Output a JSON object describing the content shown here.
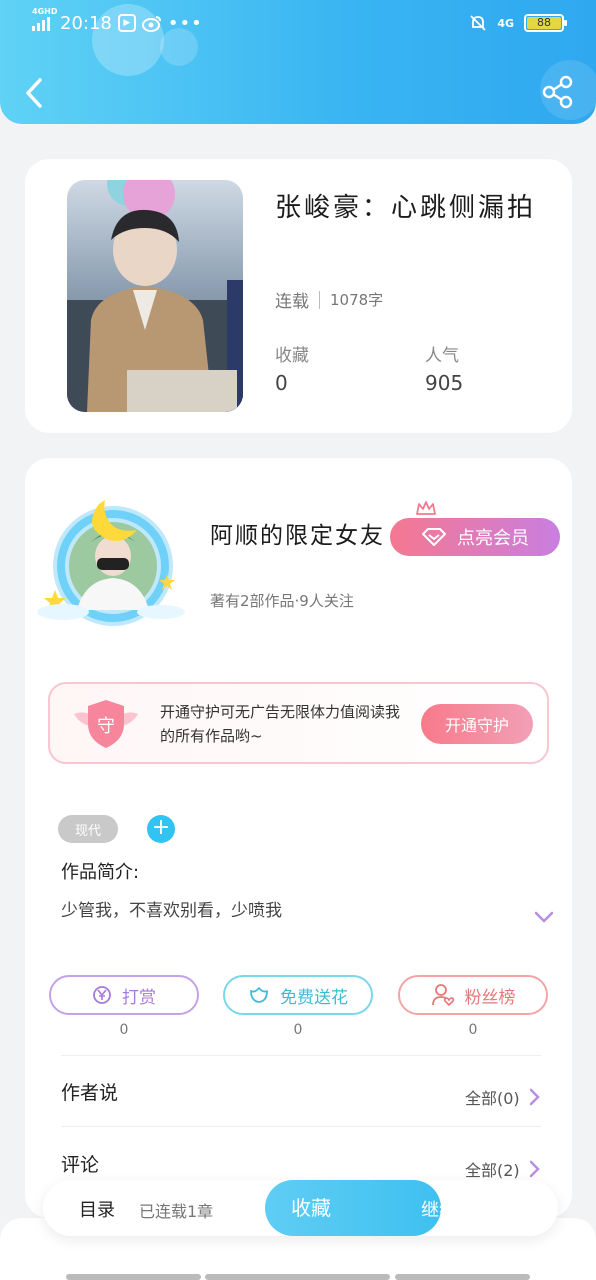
{
  "status_bar": {
    "network": "4GHD",
    "time": "20:18",
    "net_right": "4G",
    "battery": "88"
  },
  "book": {
    "title": "张峻豪：心跳侧漏拍",
    "status": "连载",
    "words": "1078字",
    "favorites_label": "收藏",
    "favorites_value": "0",
    "popularity_label": "人气",
    "popularity_value": "905"
  },
  "author": {
    "name": "阿顺的限定女友",
    "sub": "著有2部作品·9人关注",
    "vip_button": "点亮会员"
  },
  "guard": {
    "badge_char": "守",
    "text": "开通守护可无广告无限体力值阅读我的所有作品哟~",
    "button": "开通守护"
  },
  "tags": {
    "items": [
      "现代"
    ],
    "add": "+"
  },
  "intro": {
    "label": "作品简介:",
    "text": "少管我，不喜欢别看，少喷我"
  },
  "actions": [
    {
      "label": "打赏",
      "count": "0",
      "color": "#a77ad9"
    },
    {
      "label": "免费送花",
      "count": "0",
      "color": "#3dbcd8"
    },
    {
      "label": "粉丝榜",
      "count": "0",
      "color": "#e77878"
    }
  ],
  "sections": {
    "author_says": {
      "label": "作者说",
      "link": "全部(0)"
    },
    "comments": {
      "label": "评论",
      "link": "全部(2)"
    }
  },
  "bottom_bar": {
    "toc": "目录",
    "toc_sub": "已连载1章",
    "favorite": "收藏",
    "continue": "继续阅读"
  },
  "colors": {
    "header_start": "#5fd2f5",
    "header_end": "#2fa8f0",
    "accent_blue": "#31c3f1",
    "vip_pink": "#f57890"
  }
}
